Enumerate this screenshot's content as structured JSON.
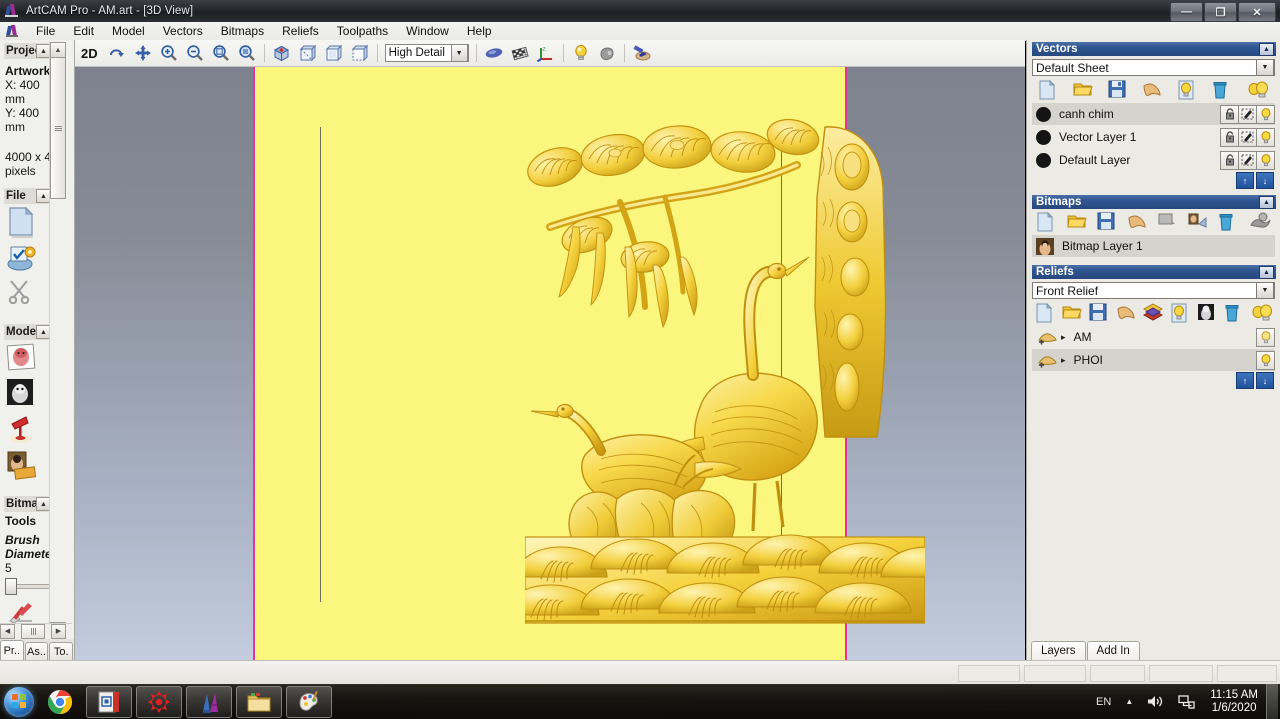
{
  "window": {
    "title": "ArtCAM Pro - AM.art - [3D View]",
    "app_icon": "artcam-icon",
    "minimize": "—",
    "restore": "❐",
    "close": "✕"
  },
  "menubar": {
    "items": [
      {
        "label": "File"
      },
      {
        "label": "Edit"
      },
      {
        "label": "Model"
      },
      {
        "label": "Vectors"
      },
      {
        "label": "Bitmaps"
      },
      {
        "label": "Reliefs"
      },
      {
        "label": "Toolpaths"
      },
      {
        "label": "Window"
      },
      {
        "label": "Help"
      }
    ]
  },
  "toolbar": {
    "mode_label": "2D",
    "detail_select": "High Detail",
    "buttons": [
      {
        "name": "rotate-view-icon"
      },
      {
        "name": "pan-view-icon"
      },
      {
        "name": "zoom-in-icon"
      },
      {
        "name": "zoom-out-icon"
      },
      {
        "name": "zoom-to-fit-icon"
      },
      {
        "name": "zoom-selected-icon"
      },
      {
        "name": "iso-view-icon"
      },
      {
        "name": "front-view-icon"
      },
      {
        "name": "side-view-icon"
      },
      {
        "name": "top-view-icon"
      },
      {
        "name": "shading-icon"
      },
      {
        "name": "wireframe-icon"
      },
      {
        "name": "axis-icon"
      },
      {
        "name": "light-icon"
      },
      {
        "name": "material-icon"
      },
      {
        "name": "paint-relief-icon"
      }
    ]
  },
  "sidebar": {
    "sections": [
      {
        "title": "Project Informa",
        "title_full": "Project Information",
        "lines": [
          "Artwork",
          "X: 400",
          "mm",
          "Y: 400",
          "mm",
          "4000 x 4",
          "pixels"
        ]
      },
      {
        "title": "File",
        "title_full": "File"
      },
      {
        "title": "Model",
        "title_full": "Model"
      },
      {
        "title": "Bitmap",
        "title_full": "Bitmap Tools",
        "subtitle": "Tools"
      }
    ],
    "artwork_label": "Artwork",
    "x_line": "X: 400",
    "x_unit": "mm",
    "y_line": "Y: 400",
    "y_unit": "mm",
    "pixels_line": "4000 x 4",
    "pixels_unit": "pixels",
    "file_title": "File",
    "model_title": "Model",
    "bitmap_title": "Bitmap",
    "bitmap_subtitle": "Tools",
    "brush_label_1": "Brush",
    "brush_label_2": "Diamete",
    "brush_value": "5",
    "collapse_glyph": "▲",
    "file_icons": [
      {
        "name": "new-model-icon"
      },
      {
        "name": "open-project-icon"
      },
      {
        "name": "cut-icon"
      }
    ],
    "model_icons": [
      {
        "name": "create-model-icon"
      },
      {
        "name": "grayscale-model-icon"
      },
      {
        "name": "light-setup-icon"
      },
      {
        "name": "texture-image-icon"
      }
    ],
    "brush_icon": {
      "name": "paint-brush-icon"
    },
    "tabs": [
      {
        "label": "Pr..",
        "name": "tab-project",
        "active": true
      },
      {
        "label": "As..",
        "name": "tab-assistant",
        "active": false
      },
      {
        "label": "To.",
        "name": "tab-toolpaths",
        "active": false
      }
    ]
  },
  "vectors_panel": {
    "title": "Vectors",
    "sheet_value": "Default Sheet",
    "toolbar_icons": [
      {
        "name": "new-vector-layer-icon"
      },
      {
        "name": "open-vector-icon"
      },
      {
        "name": "save-vector-icon"
      },
      {
        "name": "merge-vector-icon"
      },
      {
        "name": "show-layer-icon"
      },
      {
        "name": "delete-layer-icon"
      },
      {
        "name": "show-all-layers-icon"
      }
    ],
    "layers": [
      {
        "name": "canh chim",
        "selected": true
      },
      {
        "name": "Vector Layer 1",
        "selected": false
      },
      {
        "name": "Default Layer",
        "selected": false
      }
    ],
    "move_up": "↑",
    "move_down": "↓"
  },
  "bitmaps_panel": {
    "title": "Bitmaps",
    "toolbar_icons": [
      {
        "name": "new-bitmap-layer-icon"
      },
      {
        "name": "open-bitmap-icon"
      },
      {
        "name": "save-bitmap-icon"
      },
      {
        "name": "merge-bitmap-icon"
      },
      {
        "name": "copy-bitmap-icon"
      },
      {
        "name": "bitmap-to-vector-icon"
      },
      {
        "name": "delete-bitmap-icon"
      },
      {
        "name": "show-all-bitmaps-icon"
      }
    ],
    "layers": [
      {
        "name": "Bitmap Layer 1",
        "selected": true
      }
    ]
  },
  "reliefs_panel": {
    "title": "Reliefs",
    "relief_value": "Front Relief",
    "toolbar_icons": [
      {
        "name": "new-relief-layer-icon"
      },
      {
        "name": "open-relief-icon"
      },
      {
        "name": "save-relief-icon"
      },
      {
        "name": "merge-relief-icon"
      },
      {
        "name": "stack-relief-icon"
      },
      {
        "name": "show-relief-icon"
      },
      {
        "name": "relief-to-bitmap-icon"
      },
      {
        "name": "delete-relief-icon"
      },
      {
        "name": "show-all-reliefs-icon"
      }
    ],
    "layers": [
      {
        "name": "AM",
        "selected": false,
        "expand": "▸"
      },
      {
        "name": "PHOI",
        "selected": true,
        "expand": "▸"
      }
    ],
    "move_up": "↑",
    "move_down": "↓"
  },
  "right_tabs": [
    {
      "label": "Layers",
      "name": "tab-layers"
    },
    {
      "label": "Add In",
      "name": "tab-add-in"
    }
  ],
  "viewport": {
    "name": "3d-view-canvas",
    "sheet_color": "#fbf77e",
    "border_color": "#e0359a",
    "relief_color": "#f5d23c",
    "background_top": "#7d828e",
    "background_bottom": "#c3ccdd",
    "artwork_description": "Golden relief carving of cranes and pine trees over clouds"
  },
  "taskbar": {
    "start": "start-orb",
    "items": [
      {
        "name": "google-chrome-icon"
      },
      {
        "name": "foxit-reader-icon"
      },
      {
        "name": "artcam-taskbar-icon"
      },
      {
        "name": "artcam-window-icon"
      },
      {
        "name": "windows-explorer-icon"
      },
      {
        "name": "paint-icon"
      }
    ],
    "tray": {
      "language": "EN",
      "show_hidden": "▲",
      "volume": "speaker-icon",
      "network": "network-icon",
      "time": "11:15 AM",
      "date": "1/6/2020"
    }
  }
}
